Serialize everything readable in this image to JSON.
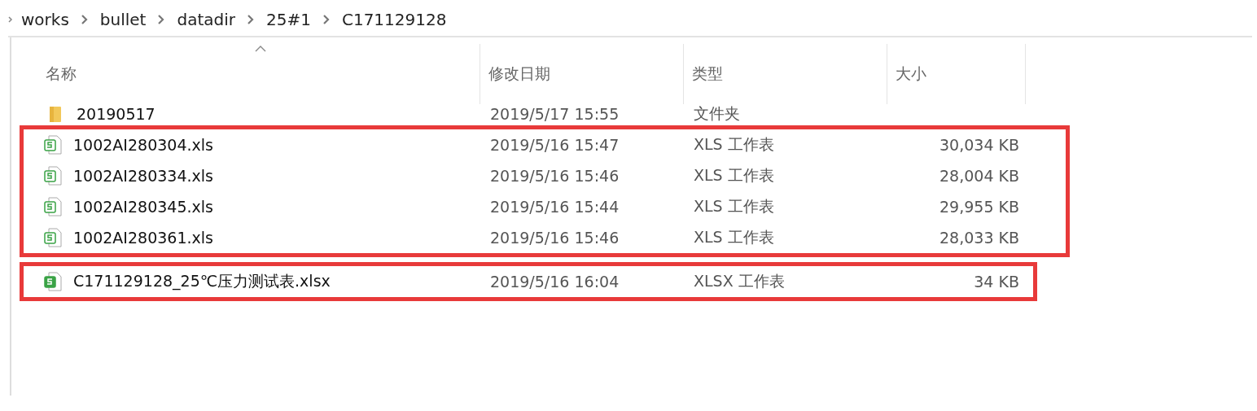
{
  "breadcrumb": [
    "works",
    "bullet",
    "datadir",
    "25#1",
    "C171129128"
  ],
  "columns": [
    {
      "label": "名称",
      "sorted": true
    },
    {
      "label": "修改日期",
      "sorted": false
    },
    {
      "label": "类型",
      "sorted": false
    },
    {
      "label": "大小",
      "sorted": false
    }
  ],
  "groups": [
    {
      "highlighted": false,
      "rows": [
        {
          "kind": "folder",
          "name": "20190517",
          "modified": "2019/5/17 15:55",
          "type": "文件夹"
        }
      ]
    },
    {
      "highlighted": true,
      "rows": [
        {
          "kind": "xls",
          "name": "1002AI280304.xls",
          "modified": "2019/5/16 15:47",
          "type": "XLS 工作表",
          "size": "30,034 KB"
        },
        {
          "kind": "xls",
          "name": "1002AI280334.xls",
          "modified": "2019/5/16 15:46",
          "type": "XLS 工作表",
          "size": "28,004 KB"
        },
        {
          "kind": "xls",
          "name": "1002AI280345.xls",
          "modified": "2019/5/16 15:44",
          "type": "XLS 工作表",
          "size": "29,955 KB"
        },
        {
          "kind": "xls",
          "name": "1002AI280361.xls",
          "modified": "2019/5/16 15:46",
          "type": "XLS 工作表",
          "size": "28,033 KB"
        }
      ]
    },
    {
      "highlighted": true,
      "rows": [
        {
          "kind": "xlsx",
          "name": "C171129128_25℃压力测试表.xlsx",
          "modified": "2019/5/16 16:04",
          "type": "XLSX 工作表",
          "size": "34 KB"
        }
      ]
    }
  ]
}
